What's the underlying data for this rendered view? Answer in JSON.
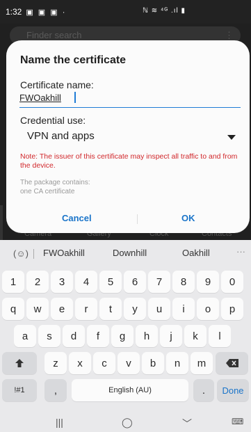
{
  "status_bar": {
    "time": "1:32",
    "left_icons": "▣ ▣ ▣ ·",
    "right_icons": "ℕ ≋ ⁴ᴳ .ıl ▮"
  },
  "background": {
    "search_placeholder": "Finder search",
    "tabs": [
      "Camera",
      "Gallery",
      "Clock",
      "Contacts"
    ]
  },
  "dialog": {
    "title": "Name the certificate",
    "name_label": "Certificate name:",
    "name_value": "FWOakhill",
    "credential_label": "Credential use:",
    "credential_value": "VPN and apps",
    "note": "Note: The issuer of this certificate may inspect all traffic to and from the device.",
    "package_label": "The package contains:",
    "package_value": "one CA certificate",
    "cancel_label": "Cancel",
    "ok_label": "OK",
    "accent_color": "#1a74c9",
    "warning_color": "#d1272b"
  },
  "keyboard": {
    "suggestions": [
      "FWOakhill",
      "Downhill",
      "Oakhill"
    ],
    "more_label": "···",
    "numbers": [
      "1",
      "2",
      "3",
      "4",
      "5",
      "6",
      "7",
      "8",
      "9",
      "0"
    ],
    "row1": [
      "q",
      "w",
      "e",
      "r",
      "t",
      "y",
      "u",
      "i",
      "o",
      "p"
    ],
    "row2": [
      "a",
      "s",
      "d",
      "f",
      "g",
      "h",
      "j",
      "k",
      "l"
    ],
    "row3": [
      "z",
      "x",
      "c",
      "v",
      "b",
      "n",
      "m"
    ],
    "symbols_label": "!#1",
    "comma_label": ",",
    "space_label": "English (AU)",
    "period_label": ".",
    "done_label": "Done",
    "shift_icon": "shift-icon",
    "backspace_icon": "backspace-icon",
    "emoji_icon": "emoji-icon"
  },
  "nav_bar": {
    "recents": "|||",
    "home": "◯",
    "back": "﹀",
    "keyboard_icon": "⌨"
  }
}
